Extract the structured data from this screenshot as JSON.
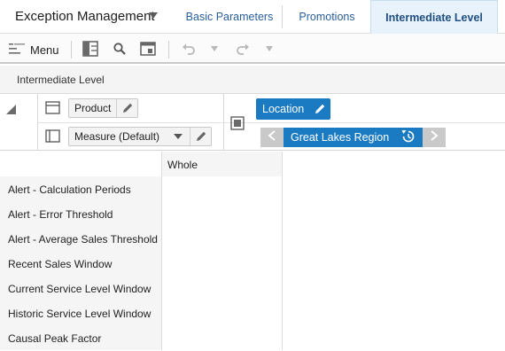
{
  "header": {
    "app_title": "Exception Management",
    "tabs": [
      {
        "label": "Basic Parameters",
        "active": false
      },
      {
        "label": "Promotions",
        "active": false
      },
      {
        "label": "Intermediate Level",
        "active": true
      }
    ]
  },
  "toolbar": {
    "menu_label": "Menu",
    "icons": [
      "split-view-icon",
      "search-icon",
      "table-icon",
      "undo-icon",
      "chevron-down-icon",
      "redo-icon",
      "chevron-down-icon"
    ]
  },
  "section": {
    "title": "Intermediate Level"
  },
  "pivot": {
    "row_dims": [
      {
        "label": "Product"
      },
      {
        "label": "Measure (Default)"
      }
    ],
    "column_dim": {
      "label": "Location"
    },
    "page_selector": {
      "label": "Great Lakes Region"
    }
  },
  "grid": {
    "column_header": "Whole",
    "rows": [
      {
        "label": "Alert - Calculation Periods",
        "value": ""
      },
      {
        "label": "Alert - Error Threshold",
        "value": ""
      },
      {
        "label": "Alert - Average Sales Threshold",
        "value": ""
      },
      {
        "label": "Recent Sales Window",
        "value": ""
      },
      {
        "label": "Current Service Level Window",
        "value": ""
      },
      {
        "label": "Historic Service Level Window",
        "value": ""
      },
      {
        "label": "Causal Peak Factor",
        "value": ""
      }
    ]
  },
  "colors": {
    "accent": "#1a7ac2",
    "tab_text": "#2a5e9a",
    "active_tab_bg": "#e8f2fb"
  }
}
